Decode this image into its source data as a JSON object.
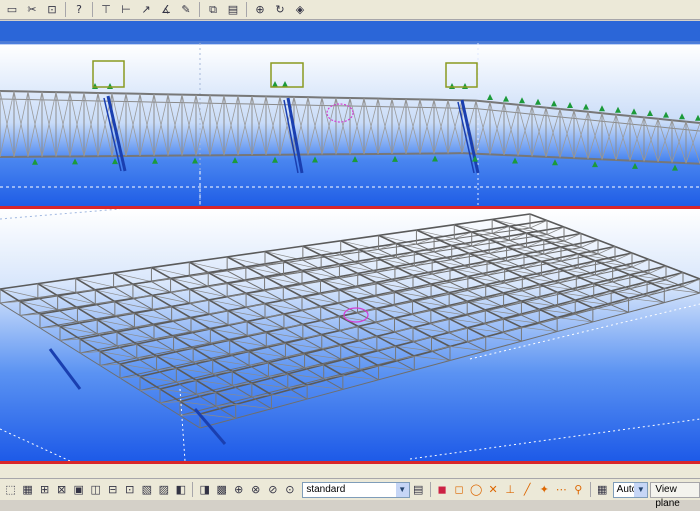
{
  "top_toolbar": {
    "icons": [
      "create-view-icon",
      "cut-icon",
      "select-icon",
      "help-icon",
      "grid-icon",
      "workplane-icon",
      "snap-icon",
      "measure-icon",
      "paint-icon",
      "copy-icon",
      "properties-icon",
      "zoom-icon",
      "refresh-icon",
      "display-icon"
    ]
  },
  "bottom_toolbar": {
    "icons_left": [
      "select-all-icon",
      "select-part-icon",
      "select-weld-icon",
      "select-bolt-icon",
      "select-assembly-icon",
      "select-component-icon",
      "select-grid-icon",
      "select-point-icon",
      "select-plane-icon",
      "select-view-icon",
      "select-cut-icon",
      "select-reference-icon",
      "select-object-icon",
      "select-filter-icon",
      "snap-1-icon",
      "snap-2-icon",
      "snap-3-icon",
      "snap-4-icon",
      "snap-5-icon"
    ],
    "filter_value": "standard",
    "icons_right": [
      "snap-end-icon",
      "snap-mid-icon",
      "snap-center-icon",
      "snap-intersect-icon",
      "snap-perp-icon",
      "snap-line-icon",
      "snap-free-icon",
      "snap-extension-icon",
      "snap-override-icon"
    ],
    "view_mode_value": "Auto",
    "plane_button": "View plane"
  },
  "colors": {
    "sky_top": "#ffffff",
    "sky_bottom": "#1f66ee",
    "steel": "#777777",
    "accent_red": "#d8262a",
    "bracing_blue": "#1a3fb0",
    "support_green": "#1c9a3a"
  }
}
